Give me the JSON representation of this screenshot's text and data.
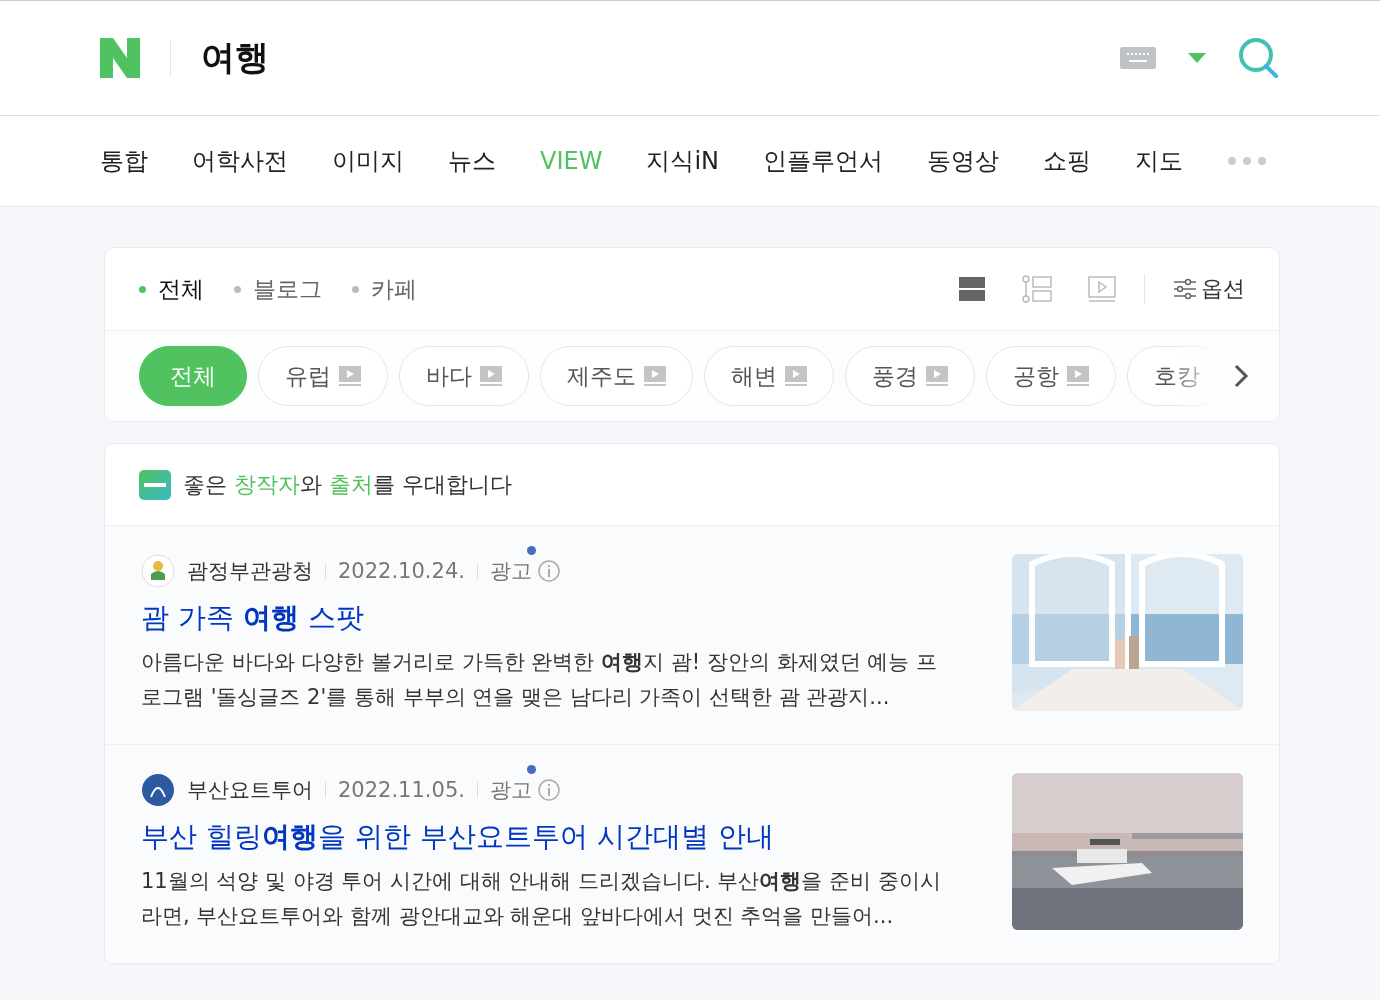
{
  "header": {
    "query": "여행"
  },
  "nav": [
    {
      "label": "통합",
      "selected": false
    },
    {
      "label": "어학사전",
      "selected": false
    },
    {
      "label": "이미지",
      "selected": false
    },
    {
      "label": "뉴스",
      "selected": false
    },
    {
      "label": "VIEW",
      "selected": true
    },
    {
      "label": "지식iN",
      "selected": false
    },
    {
      "label": "인플루언서",
      "selected": false
    },
    {
      "label": "동영상",
      "selected": false
    },
    {
      "label": "쇼핑",
      "selected": false
    },
    {
      "label": "지도",
      "selected": false
    }
  ],
  "filters": [
    {
      "label": "전체",
      "selected": true
    },
    {
      "label": "블로그",
      "selected": false
    },
    {
      "label": "카페",
      "selected": false
    }
  ],
  "view_modes": [
    {
      "kind": "list",
      "selected": true
    },
    {
      "kind": "thumb",
      "selected": false
    },
    {
      "kind": "video",
      "selected": false
    }
  ],
  "options_label": "옵션",
  "chips": [
    {
      "label": "전체",
      "selected": true
    },
    {
      "label": "유럽",
      "selected": false
    },
    {
      "label": "바다",
      "selected": false
    },
    {
      "label": "제주도",
      "selected": false
    },
    {
      "label": "해변",
      "selected": false
    },
    {
      "label": "풍경",
      "selected": false
    },
    {
      "label": "공항",
      "selected": false
    },
    {
      "label": "호캉",
      "selected": false
    }
  ],
  "notice": [
    {
      "text": "좋은 ",
      "highlight": false
    },
    {
      "text": "창작자",
      "highlight": true
    },
    {
      "text": "와 ",
      "highlight": false
    },
    {
      "text": "출처",
      "highlight": true
    },
    {
      "text": "를 우대합니다",
      "highlight": false
    }
  ],
  "results": [
    {
      "source": "괌정부관광청",
      "date": "2022.10.24.",
      "ad": "광고",
      "title": "괌 가족 **여행** 스팟",
      "description": "아름다운 바다와 다양한 볼거리로 가득한 완벽한 **여행**지 괌! 장안의 화제였던 예능 프로그램 '돌싱글즈 2'를 통해 부부의 연을 맺은 남다리 가족이 선택한 괌 관광지..."
    },
    {
      "source": "부산요트투어",
      "date": "2022.11.05.",
      "ad": "광고",
      "title": "부산 힐링**여행**을 위한 부산요트투어 시간대별 안내",
      "description": "11월의 석양 및 야경 투어 시간에 대해 안내해 드리겠습니다. 부산**여행**을 준비 중이시라면, 부산요트투어와 함께 광안대교와 해운대 앞바다에서 멋진 추억을 만들어..."
    }
  ]
}
